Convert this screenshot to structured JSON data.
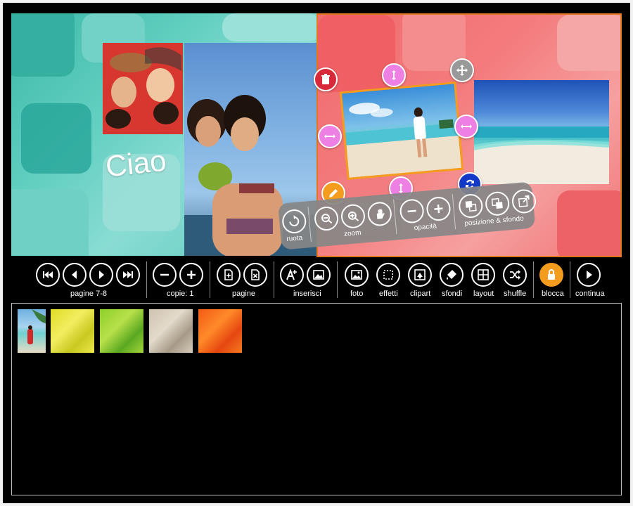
{
  "canvas": {
    "ciao_text": "Ciao"
  },
  "photo_toolbar": {
    "rotate_label": "ruota",
    "zoom_label": "zoom",
    "opacity_label": "opacità",
    "position_label": "posizione & sfondo"
  },
  "toolbar": {
    "pages_nav_label": "pagine 7-8",
    "copies_label": "copie: 1",
    "pages_label": "pagine",
    "insert_label": "inserisci",
    "photo_label": "foto",
    "effects_label": "effetti",
    "clipart_label": "clipart",
    "backgrounds_label": "sfondi",
    "layout_label": "layout",
    "shuffle_label": "shuffle",
    "lock_label": "blocca",
    "continue_label": "continua"
  },
  "colors": {
    "handle_pink": "#ee7fe3",
    "delete_red": "#d8293a",
    "edit_orange": "#f39c1e",
    "swap_blue": "#1238c8",
    "lock_orange": "#f39c1e",
    "page_border": "#e0781f"
  },
  "icons": [
    "first-page-icon",
    "prev-page-icon",
    "next-page-icon",
    "last-page-icon",
    "minus-icon",
    "plus-icon",
    "add-page-icon",
    "remove-page-icon",
    "add-text-icon",
    "insert-image-icon",
    "photo-icon",
    "effects-icon",
    "clipart-icon",
    "backgrounds-icon",
    "layout-icon",
    "shuffle-icon",
    "lock-icon",
    "play-icon"
  ]
}
